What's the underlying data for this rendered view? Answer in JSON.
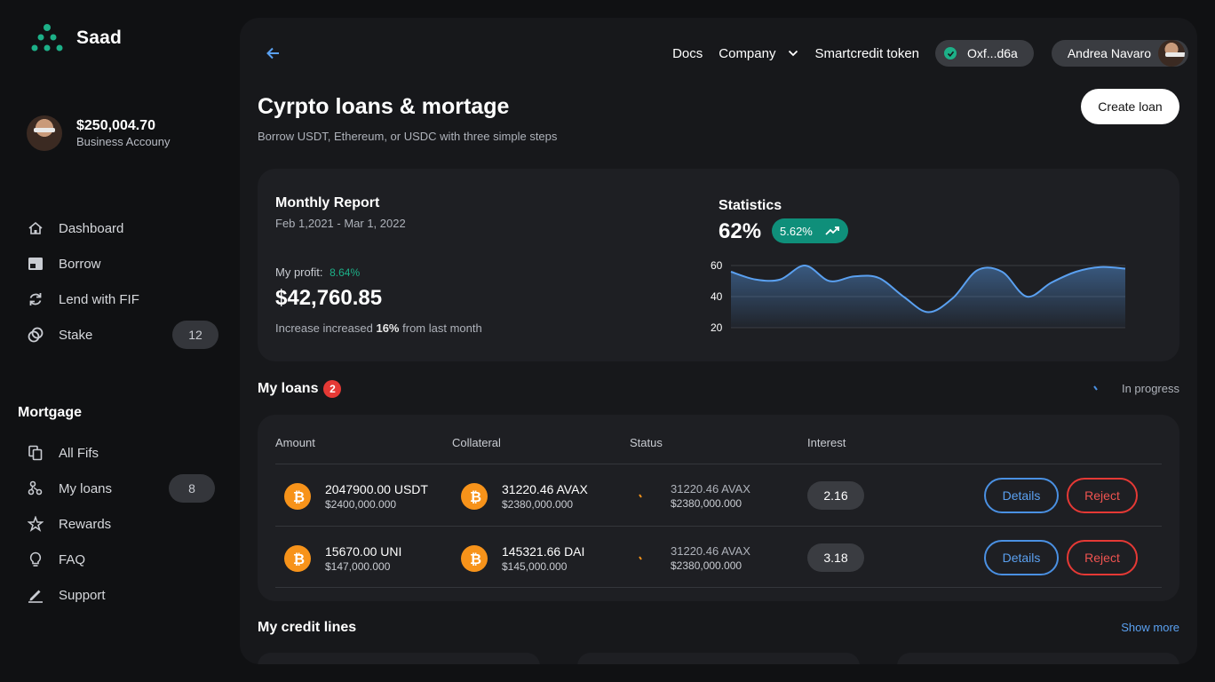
{
  "brand": {
    "name": "Saad",
    "accent": "#1db088"
  },
  "account": {
    "balance": "$250,004.70",
    "type": "Business Accouny"
  },
  "nav": [
    {
      "label": "Dashboard",
      "icon": "home-icon"
    },
    {
      "label": "Borrow",
      "icon": "wallet-icon"
    },
    {
      "label": "Lend with FIF",
      "icon": "refresh-icon"
    },
    {
      "label": "Stake",
      "icon": "coins-icon",
      "badge": "12"
    }
  ],
  "mortgage": {
    "title": "Mortgage",
    "items": [
      {
        "label": "All Fifs",
        "icon": "copy-icon"
      },
      {
        "label": "My loans",
        "icon": "network-icon",
        "badge": "8"
      },
      {
        "label": "Rewards",
        "icon": "star-icon"
      },
      {
        "label": "FAQ",
        "icon": "bulb-icon"
      },
      {
        "label": "Support",
        "icon": "pen-icon"
      }
    ]
  },
  "topnav": {
    "docs": "Docs",
    "company": "Company",
    "token": "Smartcredit token",
    "wallet": "Oxf...d6a",
    "user": "Andrea Navaro"
  },
  "page": {
    "title": "Cyrpto loans & mortage",
    "subtitle": "Borrow USDT, Ethereum, or USDC with three simple steps",
    "create_button": "Create loan"
  },
  "report": {
    "title": "Monthly Report",
    "range": "Feb 1,2021 - Mar 1, 2022",
    "profit_label": "My profit:",
    "profit_pct": "8.64%",
    "amount": "$42,760.85",
    "note_prefix": "Increase increased",
    "note_pct": "16%",
    "note_suffix": "from last month"
  },
  "statistics": {
    "title": "Statistics",
    "value": "62%",
    "change": "5.62%"
  },
  "chart_data": {
    "type": "area",
    "y": [
      56,
      51,
      51,
      60,
      50,
      53,
      52,
      40,
      30,
      39,
      57,
      56,
      40,
      49,
      56,
      59,
      58
    ],
    "ylim": [
      20,
      60
    ],
    "yticks": [
      "60",
      "40",
      "20"
    ],
    "grid": true,
    "color": "#5aa0f0"
  },
  "loans": {
    "title": "My loans",
    "count": "2",
    "progress_label": "In progress",
    "headers": {
      "amount": "Amount",
      "collateral": "Collateral",
      "status": "Status",
      "interest": "Interest"
    },
    "rows": [
      {
        "amount": "2047900.00 USDT",
        "amount_usd": "$2400,000.000",
        "collateral": "31220.46 AVAX",
        "collateral_usd": "$2380,000.000",
        "status": "31220.46 AVAX",
        "status_usd": "$2380,000.000",
        "interest": "2.16",
        "details": "Details",
        "reject": "Reject"
      },
      {
        "amount": "15670.00 UNI",
        "amount_usd": "$147,000.000",
        "collateral": "145321.66 DAI",
        "collateral_usd": "$145,000.000",
        "status": "31220.46 AVAX",
        "status_usd": "$2380,000.000",
        "interest": "3.18",
        "details": "Details",
        "reject": "Reject"
      }
    ]
  },
  "credit": {
    "title": "My credit lines",
    "show_more": "Show more"
  }
}
